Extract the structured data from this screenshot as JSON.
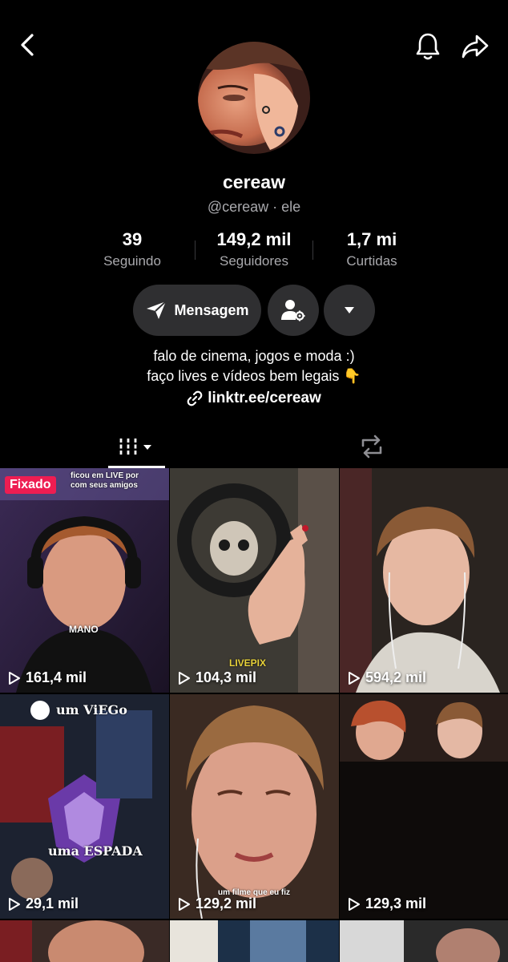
{
  "header": {
    "back_icon": "chevron-left-icon",
    "bell_icon": "bell-icon",
    "share_icon": "share-arrow-icon"
  },
  "profile": {
    "name": "cereaw",
    "handle": "@cereaw",
    "pronoun": "ele",
    "separator": "·"
  },
  "stats": [
    {
      "value": "39",
      "label": "Seguindo"
    },
    {
      "value": "149,2 mil",
      "label": "Seguidores"
    },
    {
      "value": "1,7 mi",
      "label": "Curtidas"
    }
  ],
  "actions": {
    "message_label": "Mensagem",
    "add_friend_icon": "user-gear-icon",
    "more_icon": "caret-down-icon"
  },
  "bio": {
    "line1": "falo de cinema, jogos e moda :)",
    "line2": "faço lives e vídeos bem legais 👇",
    "link": "linktr.ee/cereaw"
  },
  "tabs": [
    {
      "icon": "grid-icon",
      "active": true
    },
    {
      "icon": "repost-icon",
      "active": false
    }
  ],
  "videos": [
    {
      "views": "161,4 mil",
      "pinned_label": "Fixado",
      "caption": "MANO",
      "top_text": "ficou em LIVE por",
      "top_text2": "com seus amigos"
    },
    {
      "views": "104,3 mil",
      "caption": "LIVEPIX"
    },
    {
      "views": "594,2 mil"
    },
    {
      "views": "29,1 mil",
      "caption": "um ViEGo",
      "caption2": "uma ESPADA"
    },
    {
      "views": "129,2 mil",
      "caption": "um filme que eu fiz"
    },
    {
      "views": "129,3 mil"
    }
  ],
  "colors": {
    "background": "#000000",
    "pinned": "#ee1d52",
    "button_bg": "#2f2f31",
    "secondary_text": "#a9a9ad"
  }
}
